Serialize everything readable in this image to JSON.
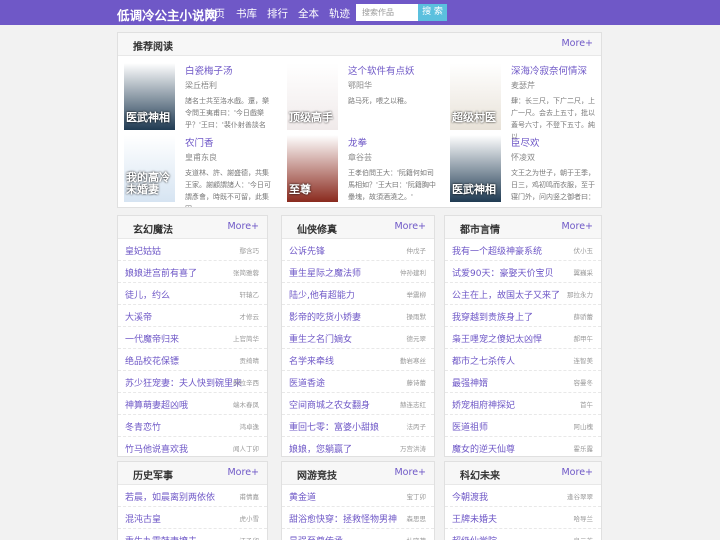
{
  "site": {
    "logo": "低调冷公主小说网"
  },
  "nav": [
    {
      "label": "首页"
    },
    {
      "label": "书库"
    },
    {
      "label": "排行"
    },
    {
      "label": "全本"
    },
    {
      "label": "轨迹"
    }
  ],
  "search": {
    "placeholder": "搜索作品",
    "button_label": "搜 索"
  },
  "featured": {
    "title": "推荐阅读",
    "more": "More+",
    "books": [
      {
        "title": "白瓷梅子汤",
        "author": "梁丘梧利",
        "desc": "諸名士共至洛水戲。還，樂令問王夷甫曰：'今日戲樂乎？'王曰：'裴仆射善談名",
        "cover_text": "医武神相",
        "cover_color": "#1f3a52"
      },
      {
        "title": "这个软件有点妖",
        "author": "鄂阳华",
        "desc": "路马死，喂之以稚。",
        "cover_text": "顶级高手",
        "cover_color": "#f0eaea"
      },
      {
        "title": "深海冷寂奈何情深",
        "author": "麦瑟芹",
        "desc": "肆：长三尺，下广二尺，上广一尺。会去上五寸，批以蓋号六寸，不登下五寸。純以",
        "cover_text": "超级村医",
        "cover_color": "#e8e2d8"
      },
      {
        "title": "农门香",
        "author": "皇甫东良",
        "desc": "支道林、許、謝盛德，共集王家。謝顧謂諸人：'今日可謂彥會，時既不可留，此集固",
        "cover_text": "我的高冷未婚妻",
        "cover_color": "#d6e4f2"
      },
      {
        "title": "龙拳",
        "author": "章谷芸",
        "desc": "王孝伯問王大：'阮籍何如司馬相如？'王大曰：'阮籍胸中壘塊，故須酒澆之。'",
        "cover_text": "至尊",
        "cover_color": "#8a2a1e"
      },
      {
        "title": "臣尽欢",
        "author": "怀凌双",
        "desc": "文王之为世子，朝于王季，日三，鸡初鸣而衣服，至于寝门外，问内竖之御者曰：",
        "cover_text": "医武神相",
        "cover_color": "#1f3a52"
      }
    ]
  },
  "categories": [
    {
      "title": "玄幻魔法",
      "more": "More+",
      "items": [
        {
          "title": "皇妃姑姑",
          "author": "鄢含巧"
        },
        {
          "title": "娘娘进宫前有喜了",
          "author": "张简雅蓉"
        },
        {
          "title": "徒儿，约么",
          "author": "轩辕乙"
        },
        {
          "title": "大溪帝",
          "author": "才修云"
        },
        {
          "title": "一代魔帝归来",
          "author": "上官简华"
        },
        {
          "title": "绝品校花保镖",
          "author": "贡绮晴"
        },
        {
          "title": "苏少狂宠妻：夫人快到碗里来",
          "author": "郝拉辛西"
        },
        {
          "title": "神算萌妻超凶哦",
          "author": "端木春凤"
        },
        {
          "title": "冬青恋竹",
          "author": "鸿卓逸"
        },
        {
          "title": "竹马他说喜欢我",
          "author": "闻人丁卯"
        }
      ]
    },
    {
      "title": "仙侠修真",
      "more": "More+",
      "items": [
        {
          "title": "公诉先锋",
          "author": "仲戊子"
        },
        {
          "title": "重生星际之魔法师",
          "author": "仲孙建利"
        },
        {
          "title": "陆少,他有超能力",
          "author": "举震柳"
        },
        {
          "title": "影帝的吃货小娇妻",
          "author": "操雨默"
        },
        {
          "title": "重生之名门嫡女",
          "author": "德元翠"
        },
        {
          "title": "名学来牵线",
          "author": "勤岩寒丝"
        },
        {
          "title": "医道香途",
          "author": "藤诗蕾"
        },
        {
          "title": "空间商城之农女翻身",
          "author": "赫连志红"
        },
        {
          "title": "重回七零：富婆小甜娘",
          "author": "法丙子"
        },
        {
          "title": "娘娘，您躺赢了",
          "author": "万宫洪涛"
        }
      ]
    },
    {
      "title": "都市言情",
      "more": "More+",
      "items": [
        {
          "title": "我有一个超级神豪系统",
          "author": "伏小玉"
        },
        {
          "title": "试爱90天：豪娶天价宝贝",
          "author": "翼巍采"
        },
        {
          "title": "公主在上，故国太子又来了",
          "author": "那拉永力"
        },
        {
          "title": "我穿越到贵族身上了",
          "author": "薛骄蕾"
        },
        {
          "title": "枭王嚜宠之傻妃太凶悍",
          "author": "郝甲午"
        },
        {
          "title": "都市之七杀传人",
          "author": "连智美"
        },
        {
          "title": "最强神婿",
          "author": "容曼冬"
        },
        {
          "title": "娇宠相府神探妃",
          "author": "首午"
        },
        {
          "title": "医道祖师",
          "author": "阿山槐"
        },
        {
          "title": "魔女的逆天仙尊",
          "author": "霍乐露"
        }
      ]
    },
    {
      "title": "历史军事",
      "more": "More+",
      "items": [
        {
          "title": "若晨，如晨离别两依依",
          "author": "甫情嘉"
        },
        {
          "title": "混沌古皇",
          "author": "虎小雪"
        },
        {
          "title": "重生九零韩妻撩夫",
          "author": "江乙卯"
        }
      ]
    },
    {
      "title": "网游竞技",
      "more": "More+",
      "items": [
        {
          "title": "黄金道",
          "author": "宝丁卯"
        },
        {
          "title": "甜浴愈快穿：拯救怪物男神",
          "author": "森思思"
        },
        {
          "title": "最强至尊传承",
          "author": "杜晓荷"
        }
      ]
    },
    {
      "title": "科幻未来",
      "more": "More+",
      "items": [
        {
          "title": "今朝渡我",
          "author": "逢谷翠翠"
        },
        {
          "title": "王牌未婚夫",
          "author": "哈导兰"
        },
        {
          "title": "超级仙学院",
          "author": "泉元芳"
        }
      ]
    }
  ]
}
